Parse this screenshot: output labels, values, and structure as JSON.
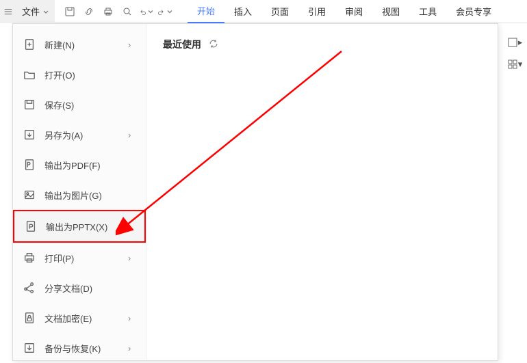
{
  "toolbar": {
    "file_label": "文件"
  },
  "tabs": {
    "start": "开始",
    "insert": "插入",
    "page": "页面",
    "reference": "引用",
    "review": "审阅",
    "view": "视图",
    "tools": "工具",
    "member": "会员专享"
  },
  "sidebar": {
    "new": "新建(N)",
    "open": "打开(O)",
    "save": "保存(S)",
    "saveas": "另存为(A)",
    "export_pdf": "输出为PDF(F)",
    "export_img": "输出为图片(G)",
    "export_pptx": "输出为PPTX(X)",
    "print": "打印(P)",
    "share": "分享文档(D)",
    "encrypt": "文档加密(E)",
    "backup": "备份与恢复(K)"
  },
  "content": {
    "recent_label": "最近使用"
  }
}
